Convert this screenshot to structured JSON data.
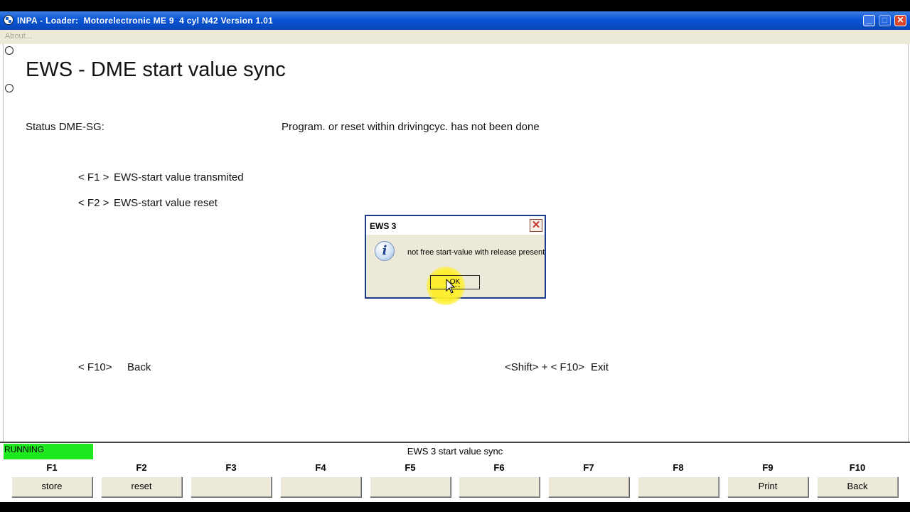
{
  "window": {
    "title": "INPA - Loader:  Motorelectronic ME 9  4 cyl N42 Version 1.01",
    "menu_about": "About..."
  },
  "main": {
    "heading": "EWS - DME start value sync",
    "status_label": "Status DME-SG:",
    "status_value": "Program. or reset within drivingcyc. has not been done",
    "options": [
      {
        "key": "< F1 >",
        "label": "EWS-start value transmited"
      },
      {
        "key": "< F2 >",
        "label": "EWS-start value reset"
      }
    ],
    "back_hint": {
      "key": "< F10>",
      "label": "Back"
    },
    "exit_hint": {
      "key": "<Shift> + < F10>",
      "label": "Exit"
    }
  },
  "dialog": {
    "title": "EWS 3",
    "message": "not free start-value with release present",
    "ok_label": "OK",
    "icon": "info-icon"
  },
  "statusbar": {
    "state": "RUNNING",
    "state_color": "#1ee81e",
    "screen_title": "EWS 3 start value sync"
  },
  "fkeys": [
    {
      "key": "F1",
      "label": "store"
    },
    {
      "key": "F2",
      "label": "reset"
    },
    {
      "key": "F3",
      "label": ""
    },
    {
      "key": "F4",
      "label": ""
    },
    {
      "key": "F5",
      "label": ""
    },
    {
      "key": "F6",
      "label": ""
    },
    {
      "key": "F7",
      "label": ""
    },
    {
      "key": "F8",
      "label": ""
    },
    {
      "key": "F9",
      "label": "Print"
    },
    {
      "key": "F10",
      "label": "Back"
    }
  ]
}
